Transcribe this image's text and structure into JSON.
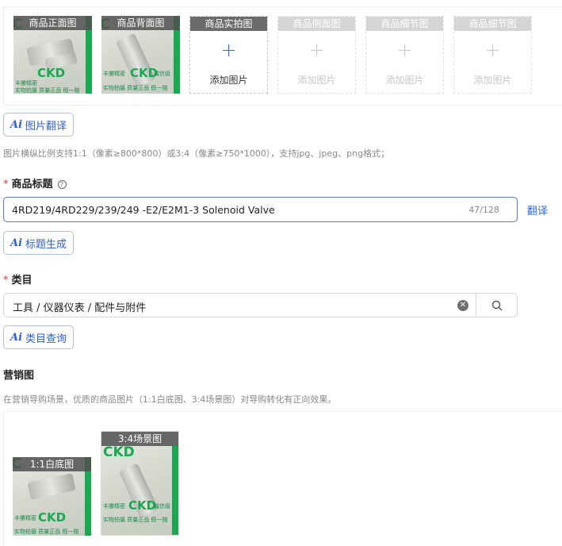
{
  "images": {
    "slots": [
      {
        "label": "商品正面图",
        "filled": true
      },
      {
        "label": "商品背面图",
        "filled": true
      },
      {
        "label": "商品实拍图",
        "filled": false,
        "enabled": true,
        "add_label": "添加图片"
      },
      {
        "label": "商品侧面图",
        "filled": false,
        "enabled": false,
        "add_label": "添加图片"
      },
      {
        "label": "商品细节图",
        "filled": false,
        "enabled": false,
        "add_label": "添加图片"
      },
      {
        "label": "商品细节图",
        "filled": false,
        "enabled": false,
        "add_label": "添加图片"
      }
    ],
    "photo_text": {
      "brand": "CKD",
      "line1": "丰勝精密",
      "line1b": "诚信级",
      "line2": "实物拍摄 质量正品 假一赔"
    },
    "translate_button": "图片翻译",
    "hint": "图片横纵比例支持1:1（像素≥800*800）或3:4（像素≥750*1000），支持jpg、jpeg、png格式；"
  },
  "title_field": {
    "required_mark": "*",
    "label": "商品标题",
    "help_icon": "?",
    "value": "4RD219/4RD229/239/249 -E2/E2M1-3 Solenoid Valve",
    "count": "47/128",
    "translate_link": "翻译",
    "generate_button": "标题生成"
  },
  "category": {
    "required_mark": "*",
    "label": "类目",
    "value": "工具 / 仪器仪表 / 配件与附件",
    "query_button": "类目查询"
  },
  "marketing": {
    "label": "营销图",
    "hint": "在营销导购场景，优质的商品图片（1:1白底图、3:4场景图）对导购转化有正向效果。",
    "white_bg_label": "1:1白底图",
    "scene_label": "3:4场景图"
  },
  "ai_icon": "Ai",
  "accent_color": "#2f6be0",
  "icons": [
    "plus-icon",
    "help-icon",
    "clear-icon",
    "search-icon",
    "ai-icon"
  ]
}
